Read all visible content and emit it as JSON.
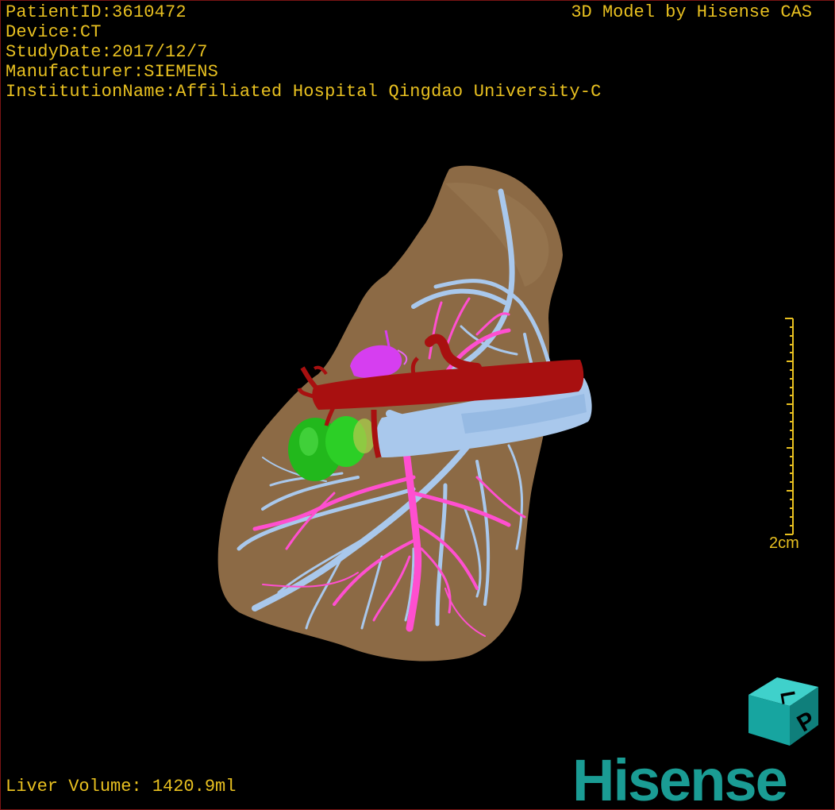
{
  "patient": {
    "id_line": "PatientID:3610472",
    "device_line": "Device:CT",
    "date_line": "StudyDate:2017/12/7",
    "manufacturer_line": "Manufacturer:SIEMENS",
    "institution_line": "InstitutionName:Affiliated Hospital Qingdao University-C"
  },
  "credit": "3D Model by Hisense CAS",
  "liver_volume": "Liver Volume: 1420.9ml",
  "scale_bar": {
    "label": "2cm"
  },
  "orientation_cube": {
    "face_top": "L",
    "face_front": "P",
    "color": "#17a5a0"
  },
  "logo": {
    "text": "Hisense",
    "color": "#1a9c94"
  },
  "colors": {
    "text": "#e8c020",
    "liver": "#8c6a45",
    "portal_vein": "#ff4fd0",
    "hepatic_vein": "#a9c8ec",
    "artery": "#a81010",
    "gallbladder": "#22b81c",
    "tumor": "#d63ef0"
  }
}
